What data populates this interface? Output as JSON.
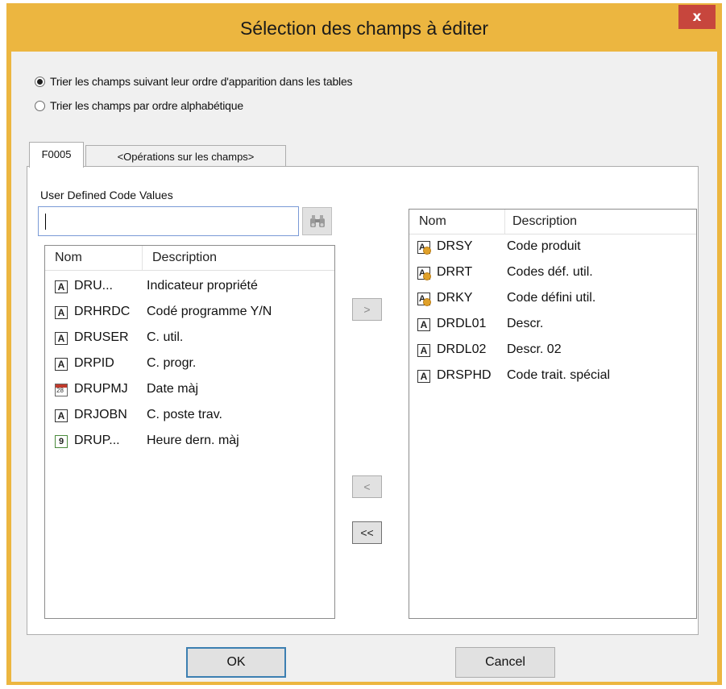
{
  "window": {
    "title": "Sélection des champs à éditer",
    "close_glyph": "x"
  },
  "sort_options": [
    {
      "label": "Trier les champs suivant leur ordre d'apparition dans les tables",
      "checked": true
    },
    {
      "label": "Trier les champs par ordre alphabétique",
      "checked": false
    }
  ],
  "tabs": [
    {
      "label": "F0005",
      "active": true
    },
    {
      "label": "<Opérations sur les champs>",
      "active": false
    }
  ],
  "udc_label": "User Defined Code Values",
  "search": {
    "value": "",
    "placeholder": "",
    "icon": "binoculars-icon"
  },
  "available_list": {
    "columns": [
      "Nom",
      "Description"
    ],
    "rows": [
      {
        "icon": "alpha-field-icon",
        "name": "DRU...",
        "description": "Indicateur propriété"
      },
      {
        "icon": "alpha-field-icon",
        "name": "DRHRDC",
        "description": "Codé programme Y/N"
      },
      {
        "icon": "alpha-field-icon",
        "name": "DRUSER",
        "description": "C. util."
      },
      {
        "icon": "alpha-field-icon",
        "name": "DRPID",
        "description": "C. progr."
      },
      {
        "icon": "date-field-icon",
        "name": "DRUPMJ",
        "description": "Date màj",
        "icon_text": "28"
      },
      {
        "icon": "alpha-field-icon",
        "name": "DRJOBN",
        "description": "C. poste trav."
      },
      {
        "icon": "numeric-field-icon",
        "name": "DRUP...",
        "description": "Heure dern. màj",
        "icon_text": "9"
      }
    ]
  },
  "selected_list": {
    "columns": [
      "Nom",
      "Description"
    ],
    "rows": [
      {
        "icon": "key-alpha-field-icon",
        "name": "DRSY",
        "description": "Code produit"
      },
      {
        "icon": "key-alpha-field-icon",
        "name": "DRRT",
        "description": "Codes déf. util."
      },
      {
        "icon": "key-alpha-field-icon",
        "name": "DRKY",
        "description": "Code défini util."
      },
      {
        "icon": "alpha-field-icon",
        "name": "DRDL01",
        "description": "Descr."
      },
      {
        "icon": "alpha-field-icon",
        "name": "DRDL02",
        "description": "Descr. 02"
      },
      {
        "icon": "alpha-field-icon",
        "name": "DRSPHD",
        "description": "Code trait. spécial"
      }
    ]
  },
  "move_buttons": {
    "add": ">",
    "remove": "<",
    "remove_all": "<<"
  },
  "buttons": {
    "ok": "OK",
    "cancel": "Cancel"
  },
  "colors": {
    "title_bar": "#ecb640",
    "close_button": "#c7463d",
    "dialog_bg": "#f0f0f0"
  }
}
